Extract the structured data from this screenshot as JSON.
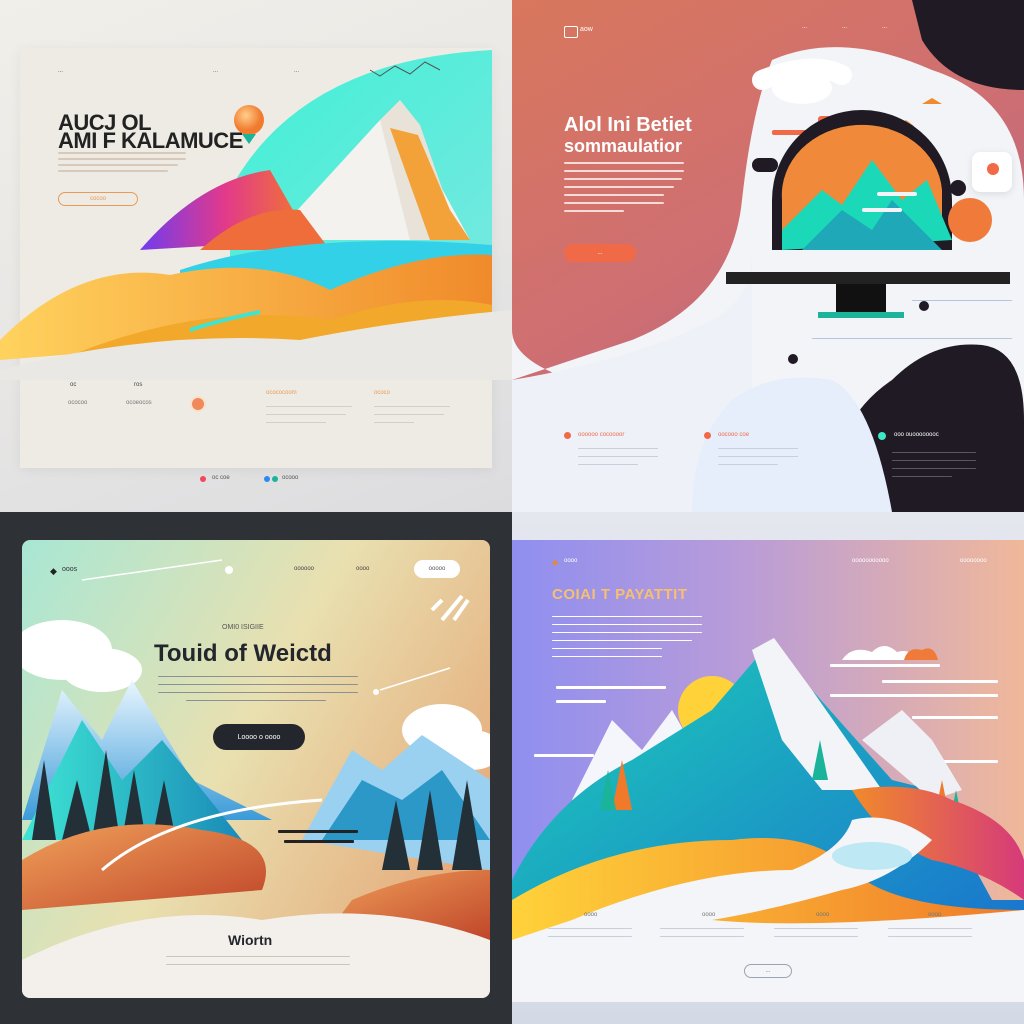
{
  "q1": {
    "nav_items": [
      "...",
      "...",
      "..."
    ],
    "title_line1": "AUCJ OL",
    "title_line2": "AMI F KALAMUCE",
    "cta_label": "cocoo",
    "features": [
      {
        "title": "oc",
        "sub": "ococoo"
      },
      {
        "title": "ros",
        "sub": "ocoeocos"
      }
    ],
    "info_titles": [
      "ocococoom",
      "ococo"
    ],
    "footer_label_1": "oc coe",
    "footer_label_2": "ocooo",
    "colors": {
      "accent": "#f08a3a",
      "teal": "#3de4d1",
      "purple": "#8b3ff0"
    }
  },
  "q2": {
    "logo_text": "aow",
    "nav_items": [
      "...",
      "...",
      "..."
    ],
    "title_line1": "Alol Ini Betiet",
    "title_line2": "sommaulatior",
    "cta_label": "...",
    "feature_labels": [
      "oooooo cocoooor",
      "oocooo coe",
      "ooo ouoooooooc"
    ],
    "colors": {
      "accent": "#f06a48",
      "dark": "#1f1a24",
      "teal": "#3ee8c4"
    }
  },
  "q3": {
    "logo_text": "ooos",
    "nav_items": [
      "oooooo",
      "oooo"
    ],
    "nav_button": "ooooo",
    "eyebrow": "OMI0 ISIGIIE",
    "title": "Touid of Weictd",
    "cta_label": "Loooo o oooo",
    "footer_title": "Wiortn",
    "colors": {
      "dark": "#23262c",
      "teal": "#38e3d3",
      "orange": "#e26a3c"
    }
  },
  "q4": {
    "logo_text": "oooo",
    "nav_items": [
      "ooooooooooo",
      "oooooooo"
    ],
    "title": "COIAI T PAYATTIT",
    "features": [
      "oooo",
      "oooo",
      "oooo",
      "oooo"
    ],
    "cta_label": "...",
    "colors": {
      "accent": "#e28a3a",
      "teal": "#1bb39a",
      "purple": "#7f7de0"
    }
  },
  "icons": {
    "balloon": "hot-air-balloon-icon",
    "monitor": "monitor-icon",
    "sun": "sun-icon",
    "tree": "pine-tree-icon",
    "mountain": "mountain-icon"
  }
}
